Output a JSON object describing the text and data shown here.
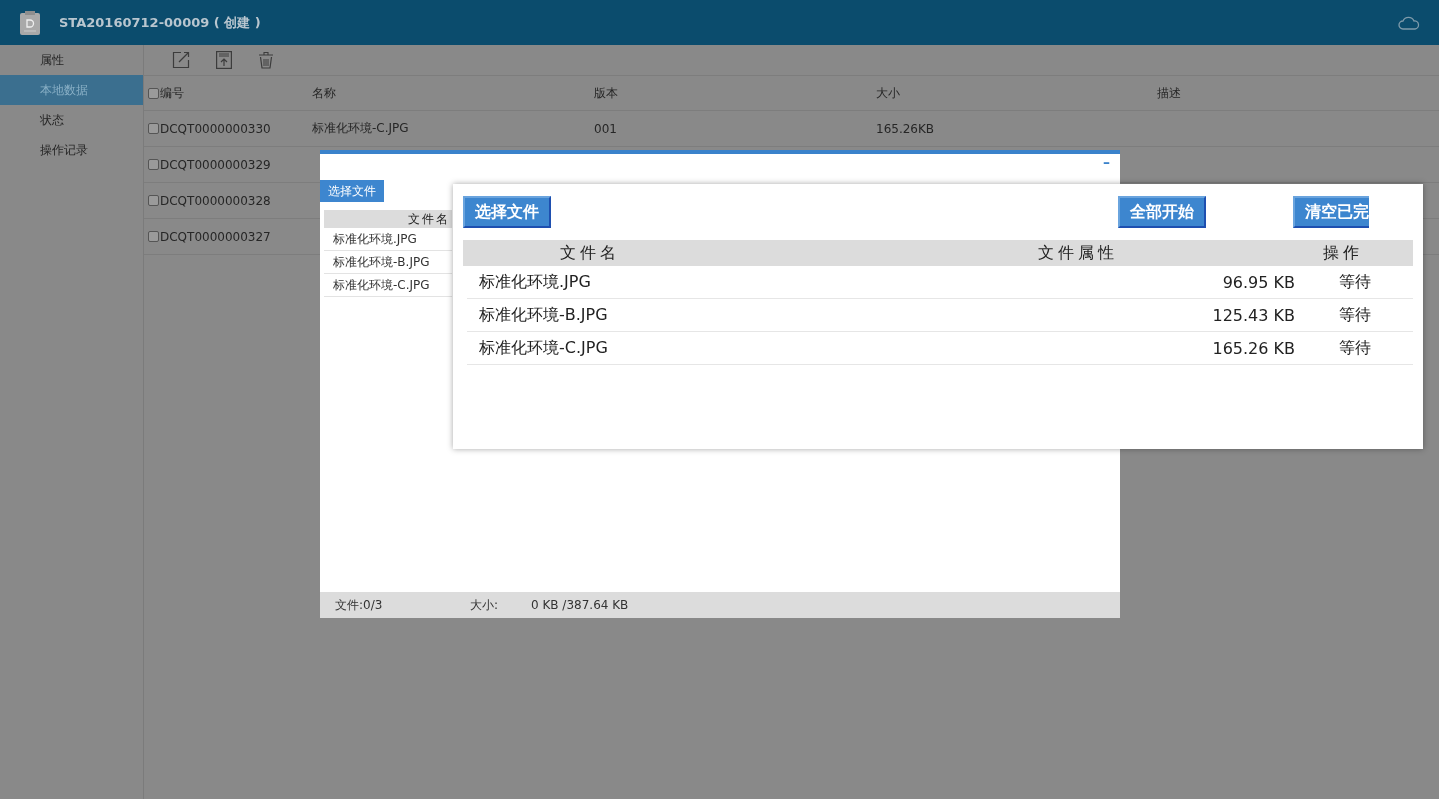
{
  "header": {
    "title": "STA20160712-00009 ( 创建 )"
  },
  "sidebar": {
    "items": [
      {
        "label": "属性",
        "selected": false
      },
      {
        "label": "本地数据",
        "selected": true
      },
      {
        "label": "状态",
        "selected": false
      },
      {
        "label": "操作记录",
        "selected": false
      }
    ]
  },
  "table": {
    "header_checked": false,
    "columns": [
      "编号",
      "名称",
      "版本",
      "大小",
      "描述"
    ],
    "rows": [
      {
        "checked": false,
        "cells": [
          "DCQT0000000330",
          "标准化环境-C.JPG",
          "001",
          "165.26KB"
        ]
      },
      {
        "checked": false,
        "cells": [
          "DCQT0000000329"
        ]
      },
      {
        "checked": false,
        "cells": [
          "DCQT0000000328"
        ]
      },
      {
        "checked": false,
        "cells": [
          "DCQT0000000327"
        ]
      }
    ]
  },
  "dialog": {
    "minimize": "–",
    "choose_button": "选择文件",
    "list_header": "文件名",
    "files": [
      "标准化环境.JPG",
      "标准化环境-B.JPG",
      "标准化环境-C.JPG"
    ],
    "footer": {
      "files": "文件:0/3",
      "size_label": "大小:",
      "size": "0 KB /387.64 KB"
    }
  },
  "inset": {
    "buttons": [
      "选择文件",
      "全部开始",
      "清空已完"
    ],
    "columns": [
      "文件名",
      "文件属性",
      "操作"
    ],
    "rows": [
      {
        "name": "标准化环境.JPG",
        "size": "96.95 KB",
        "status": "等待"
      },
      {
        "name": "标准化环境-B.JPG",
        "size": "125.43 KB",
        "status": "等待"
      },
      {
        "name": "标准化环境-C.JPG",
        "size": "165.26 KB",
        "status": "等待"
      }
    ]
  }
}
